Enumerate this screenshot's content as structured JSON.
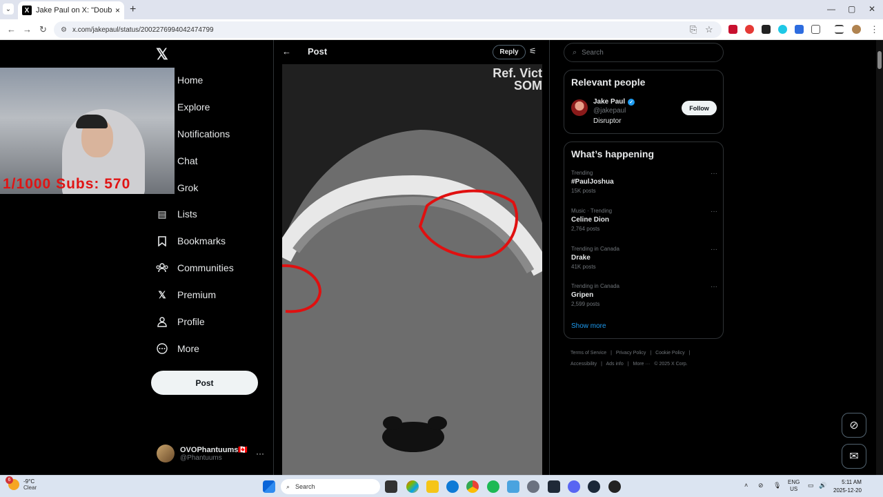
{
  "browser": {
    "tab_title": "Jake Paul on X: \"Double broken",
    "tab_close": "×",
    "new_tab": "+",
    "url": "x.com/jakepaul/status/2002276994042474799",
    "win_min": "—",
    "win_max": "▢",
    "win_close": "✕"
  },
  "webcam": {
    "subs_text": "1/1000  Subs: 570"
  },
  "nav": {
    "items": [
      {
        "label": "Home",
        "icon": "home-icon"
      },
      {
        "label": "Explore",
        "icon": "search-icon"
      },
      {
        "label": "Notifications",
        "icon": "bell-icon"
      },
      {
        "label": "Chat",
        "icon": "chat-icon"
      },
      {
        "label": "Grok",
        "icon": "grok-icon"
      },
      {
        "label": "Lists",
        "icon": "lists-icon"
      },
      {
        "label": "Bookmarks",
        "icon": "bookmark-icon"
      },
      {
        "label": "Communities",
        "icon": "communities-icon"
      },
      {
        "label": "Premium",
        "icon": "x-icon"
      },
      {
        "label": "Profile",
        "icon": "profile-icon"
      },
      {
        "label": "More",
        "icon": "more-circle-icon"
      }
    ],
    "post_label": "Post",
    "account_name": "OVOPhantuums🇨🇦",
    "account_handle": "@Phantuums",
    "account_more": "···"
  },
  "post": {
    "header_title": "Post",
    "reply_label": "Reply",
    "media_overlay_line1": "Ref. Vict",
    "media_overlay_line2": "SOM"
  },
  "right": {
    "search_placeholder": "Search",
    "relevant_title": "Relevant people",
    "person": {
      "name": "Jake Paul",
      "handle": "@jakepaul",
      "bio": "Disruptor",
      "follow_label": "Follow"
    },
    "happening_title": "What’s happening",
    "trends": [
      {
        "context": "Trending",
        "name": "#PaulJoshua",
        "count": "15K posts"
      },
      {
        "context": "Music · Trending",
        "name": "Celine Dion",
        "count": "2,764 posts"
      },
      {
        "context": "Trending in Canada",
        "name": "Drake",
        "count": "41K posts"
      },
      {
        "context": "Trending in Canada",
        "name": "Gripen",
        "count": "2,599 posts"
      }
    ],
    "trend_more": "···",
    "show_more": "Show more",
    "footer": [
      "Terms of Service",
      "|",
      "Privacy Policy",
      "|",
      "Cookie Policy",
      "|",
      "Accessibility",
      "|",
      "Ads info",
      "|",
      "More ···",
      "© 2025 X Corp."
    ]
  },
  "taskbar": {
    "weather_badge": "6",
    "temp": "-9°C",
    "condition": "Clear",
    "search_label": "Search",
    "lang_line1": "ENG",
    "lang_line2": "US",
    "time": "5:11 AM",
    "date": "2025-12-20"
  }
}
